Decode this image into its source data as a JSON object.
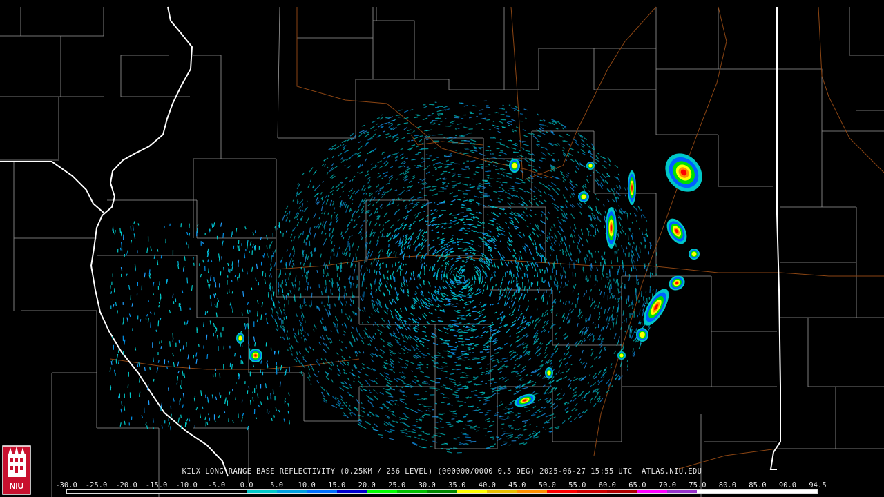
{
  "product_title": "KILX LONG RANGE BASE REFLECTIVITY (0.25KM / 256 LEVEL) (000000/0000 0.5 DEG) 2025-06-27 15:55 UTC  ATLAS.NIU.EDU",
  "logo_text": "NIU",
  "colorbar": {
    "labels": [
      "-30.0",
      "-25.0",
      "-20.0",
      "-15.0",
      "-10.0",
      "-5.0",
      "0.0",
      "5.0",
      "10.0",
      "15.0",
      "20.0",
      "25.0",
      "30.0",
      "35.0",
      "40.0",
      "45.0",
      "50.0",
      "55.0",
      "60.0",
      "65.0",
      "70.0",
      "75.0",
      "80.0",
      "85.0",
      "90.0",
      "94.5"
    ],
    "colors": [
      "#000000",
      "#000000",
      "#000000",
      "#000000",
      "#000000",
      "#000000",
      "#00c8c8",
      "#00a0e0",
      "#0070ff",
      "#0000d0",
      "#00ff00",
      "#00c000",
      "#008800",
      "#ffff00",
      "#e8c000",
      "#ff9000",
      "#ff0000",
      "#d00000",
      "#b00000",
      "#ff00ff",
      "#9933cc",
      "#ffffff",
      "#ffffff",
      "#ffffff",
      "#ffffff"
    ]
  },
  "colors": {
    "background": "#000000",
    "county_lines": "#ffffff",
    "state_lines": "#ffffff",
    "highways": "#8b4513"
  }
}
